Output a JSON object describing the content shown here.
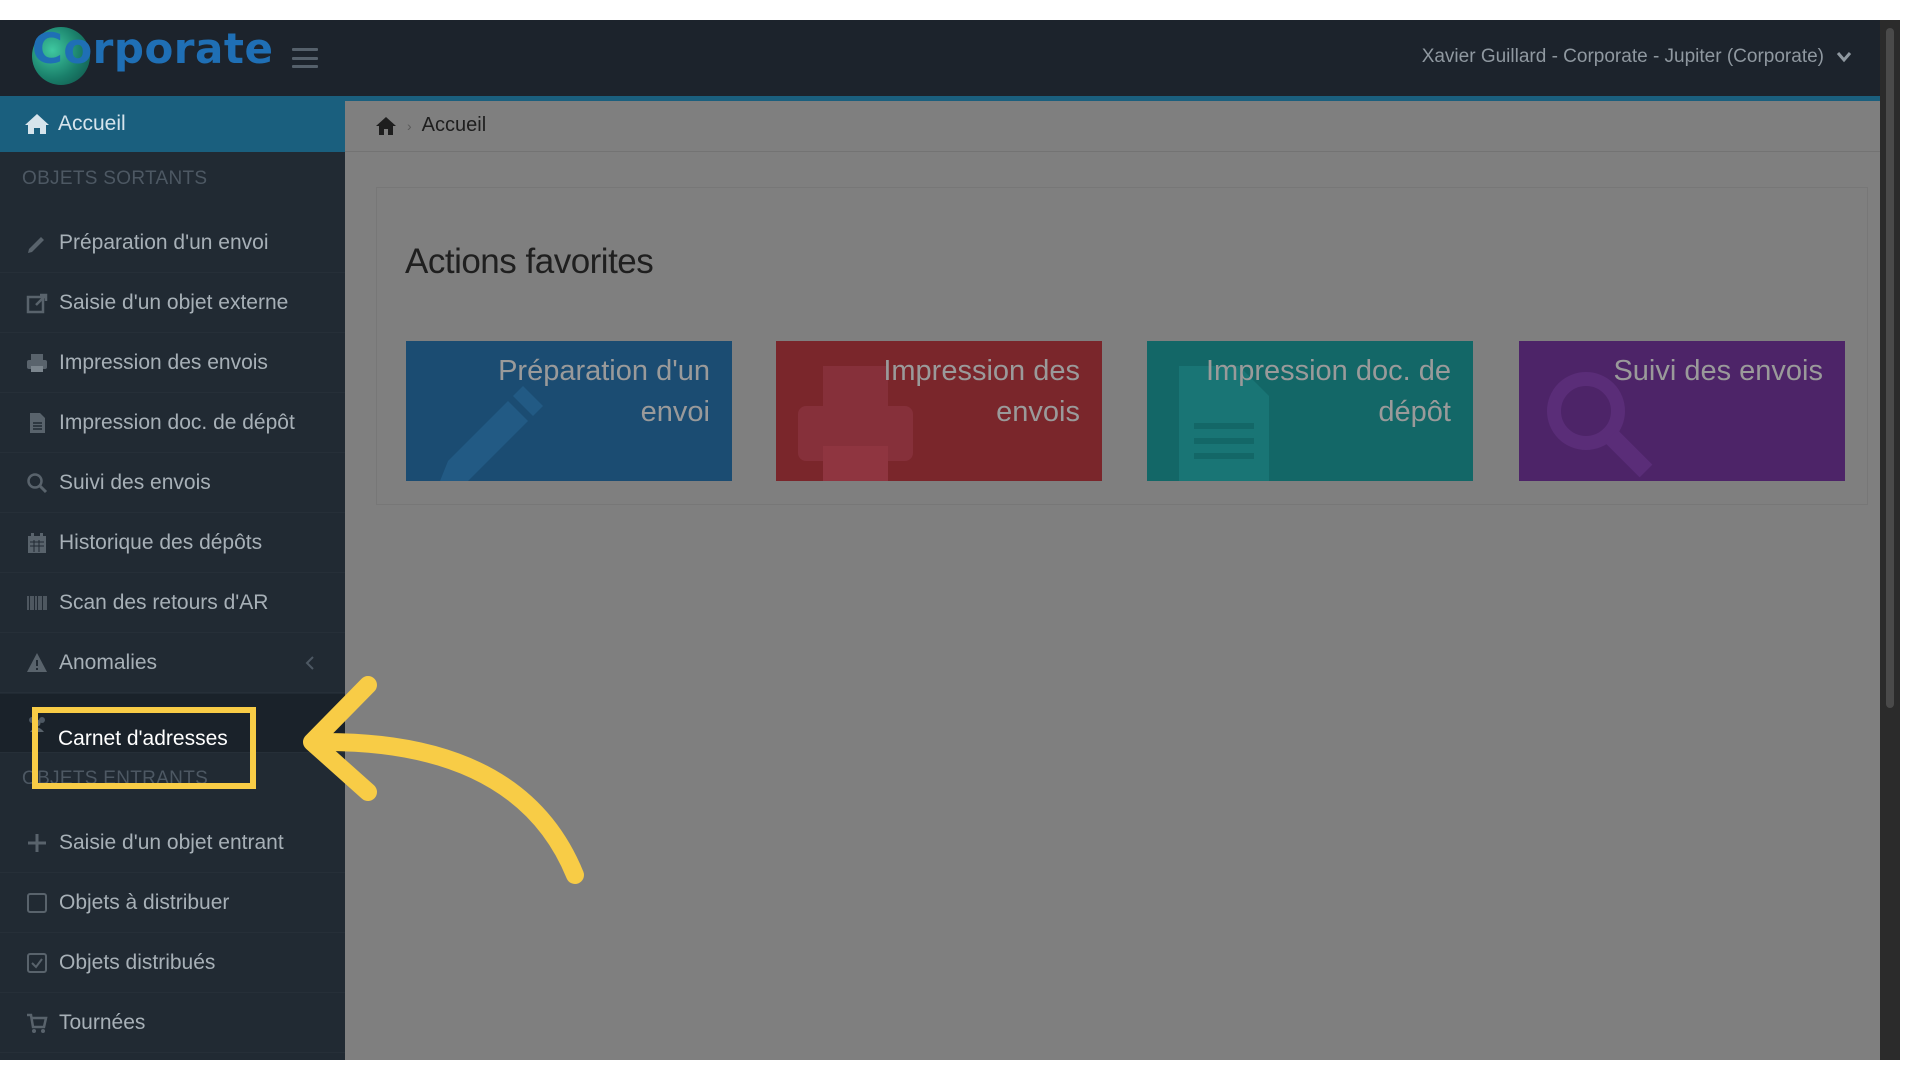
{
  "app": {
    "logo_text": "Corporate"
  },
  "header": {
    "user_menu": "Xavier Guillard - Corporate - Jupiter (Corporate)"
  },
  "sidebar": {
    "home": "Accueil",
    "section_outgoing": "OBJETS SORTANTS",
    "outgoing": [
      {
        "label": "Préparation d'un envoi",
        "icon": "pencil-icon"
      },
      {
        "label": "Saisie d'un objet externe",
        "icon": "external-edit-icon"
      },
      {
        "label": "Impression des envois",
        "icon": "printer-icon"
      },
      {
        "label": "Impression doc. de dépôt",
        "icon": "document-icon"
      },
      {
        "label": "Suivi des envois",
        "icon": "search-icon"
      },
      {
        "label": "Historique des dépôts",
        "icon": "calendar-icon"
      },
      {
        "label": "Scan des retours d'AR",
        "icon": "barcode-icon"
      },
      {
        "label": "Anomalies",
        "icon": "warning-icon"
      },
      {
        "label": "Carnet d'adresses",
        "icon": "users-icon"
      }
    ],
    "section_incoming": "OBJETS ENTRANTS",
    "incoming": [
      {
        "label": "Saisie d'un objet entrant",
        "icon": "plus-icon"
      },
      {
        "label": "Objets à distribuer",
        "icon": "checkbox-empty-icon"
      },
      {
        "label": "Objets distribués",
        "icon": "checkbox-checked-icon"
      },
      {
        "label": "Tournées",
        "icon": "cart-icon"
      }
    ]
  },
  "breadcrumb": {
    "current": "Accueil"
  },
  "main": {
    "title": "Actions favorites",
    "tiles": [
      {
        "label": "Préparation d'un\nenvoi",
        "color": "#1b4c72"
      },
      {
        "label": "Impression des\nenvois",
        "color": "#7a262b"
      },
      {
        "label": "Impression doc. de\ndépôt",
        "color": "#136767"
      },
      {
        "label": "Suivi des envois",
        "color": "#4d2468"
      }
    ]
  },
  "colors": {
    "highlight": "#f8cc46",
    "topbar": "#1c232c",
    "sidebar": "#212a33",
    "accent": "#1a5f7e"
  }
}
